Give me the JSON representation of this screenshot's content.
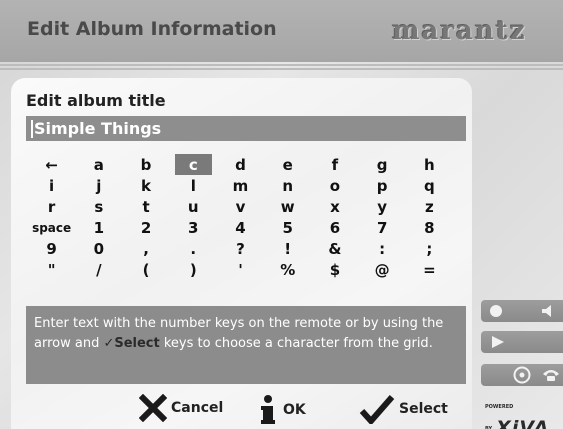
{
  "window": {
    "title": "Edit Album Information",
    "brand": "marantz"
  },
  "dialog": {
    "heading": "Edit album title",
    "input_value": "Simple Things",
    "keys": [
      "←",
      "a",
      "b",
      "c",
      "d",
      "e",
      "f",
      "g",
      "h",
      "i",
      "j",
      "k",
      "l",
      "m",
      "n",
      "o",
      "p",
      "q",
      "r",
      "s",
      "t",
      "u",
      "v",
      "w",
      "x",
      "y",
      "z",
      "space",
      "1",
      "2",
      "3",
      "4",
      "5",
      "6",
      "7",
      "8",
      "9",
      "0",
      ",",
      ".",
      "?",
      "!",
      "&",
      ":",
      ";",
      "\"",
      "/",
      "(",
      ")",
      "'",
      "%",
      "$",
      "@",
      "="
    ],
    "selected_key": "c",
    "help_text": {
      "part1": "Enter text with the number keys on the remote or by using the arrow and ",
      "highlight": "✓Select",
      "part2": " keys to choose a character from the grid."
    },
    "actions": {
      "cancel": "Cancel",
      "ok": "OK",
      "select": "Select"
    }
  },
  "side_panel": {
    "powered_by": "POWERED BY",
    "logo": "XiVA"
  },
  "icons": {
    "cancel": "x-icon",
    "ok": "info-icon",
    "select": "checkmark-icon",
    "record": "record-icon",
    "mute": "speaker-icon",
    "play": "play-icon",
    "disc": "disc-icon"
  },
  "colors": {
    "panel_bg": "#f4f4f4",
    "highlight_bar": "#8e8e8e",
    "selected_key": "#7a7a7a",
    "help_bg": "#8c8c8c"
  }
}
